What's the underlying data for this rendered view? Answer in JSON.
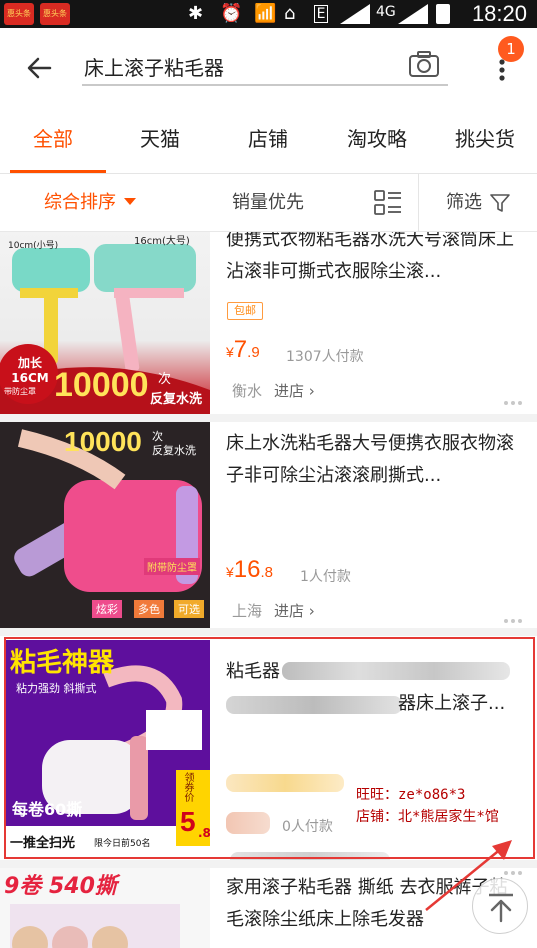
{
  "status_bar": {
    "time": "18:20",
    "network": "4G",
    "app1": "惠头条",
    "app2": "惠头条"
  },
  "header": {
    "search_value": "床上滚子粘毛器",
    "badge_count": "1"
  },
  "tabs": [
    {
      "label": "全部",
      "active": true
    },
    {
      "label": "天猫",
      "active": false
    },
    {
      "label": "店铺",
      "active": false
    },
    {
      "label": "淘攻略",
      "active": false
    },
    {
      "label": "挑尖货",
      "active": false
    }
  ],
  "sort": {
    "default_label": "综合排序",
    "sales_label": "销量优先",
    "filter_label": "筛选"
  },
  "products": [
    {
      "title": "便携式衣物粘毛器水洗大号滚筒床上沾滚非可撕式衣服除尘滚...",
      "tag": "包邮",
      "price_yen": "¥",
      "price_main": "7",
      "price_dec": ".9",
      "sales": "1307人付款",
      "location": "衡水",
      "shop": "进店 ›",
      "image_text": {
        "size_a": "10cm(小号)",
        "size_b": "16cm(大号)",
        "badge": "加长 16CM",
        "badge_sub": "带防尘罩",
        "big": "10000",
        "big_sub1": "次",
        "big_sub2": "反复水洗"
      }
    },
    {
      "title": "床上水洗粘毛器大号便携衣服衣物滚子非可除尘沾滚滚刷撕式...",
      "price_yen": "¥",
      "price_main": "16",
      "price_dec": ".8",
      "sales": "1人付款",
      "location": "上海",
      "shop": "进店 ›",
      "image_text": {
        "big": "10000",
        "big_sub1": "次",
        "big_sub2": "反复水洗",
        "cover": "附带防尘罩",
        "opt1": "炫彩",
        "opt2": "多色",
        "opt3": "可选"
      }
    },
    {
      "title_line1": "粘毛器",
      "title_line2_end": "器床上滚子...",
      "sales": "0人付款",
      "image_text": {
        "banner": "粘毛神器",
        "sub": "粘力强劲 斜撕式",
        "count": "每卷60撕",
        "bottom": "一推全扫光",
        "limit": "限今日前50名",
        "price_label": "领券价",
        "price": "5",
        "price_dec": ".8"
      }
    },
    {
      "title": "家用滚子粘毛器 撕纸 去衣服裤子粘毛滚除尘纸床上除毛发器",
      "image_text": {
        "banner": "9卷 540撕"
      }
    }
  ],
  "annotation": {
    "wangwang": "旺旺：ze*o86*3",
    "shop": "店铺：北*熊居家生*馆"
  },
  "colors": {
    "accent": "#ff5000",
    "annotation": "#e53935"
  }
}
